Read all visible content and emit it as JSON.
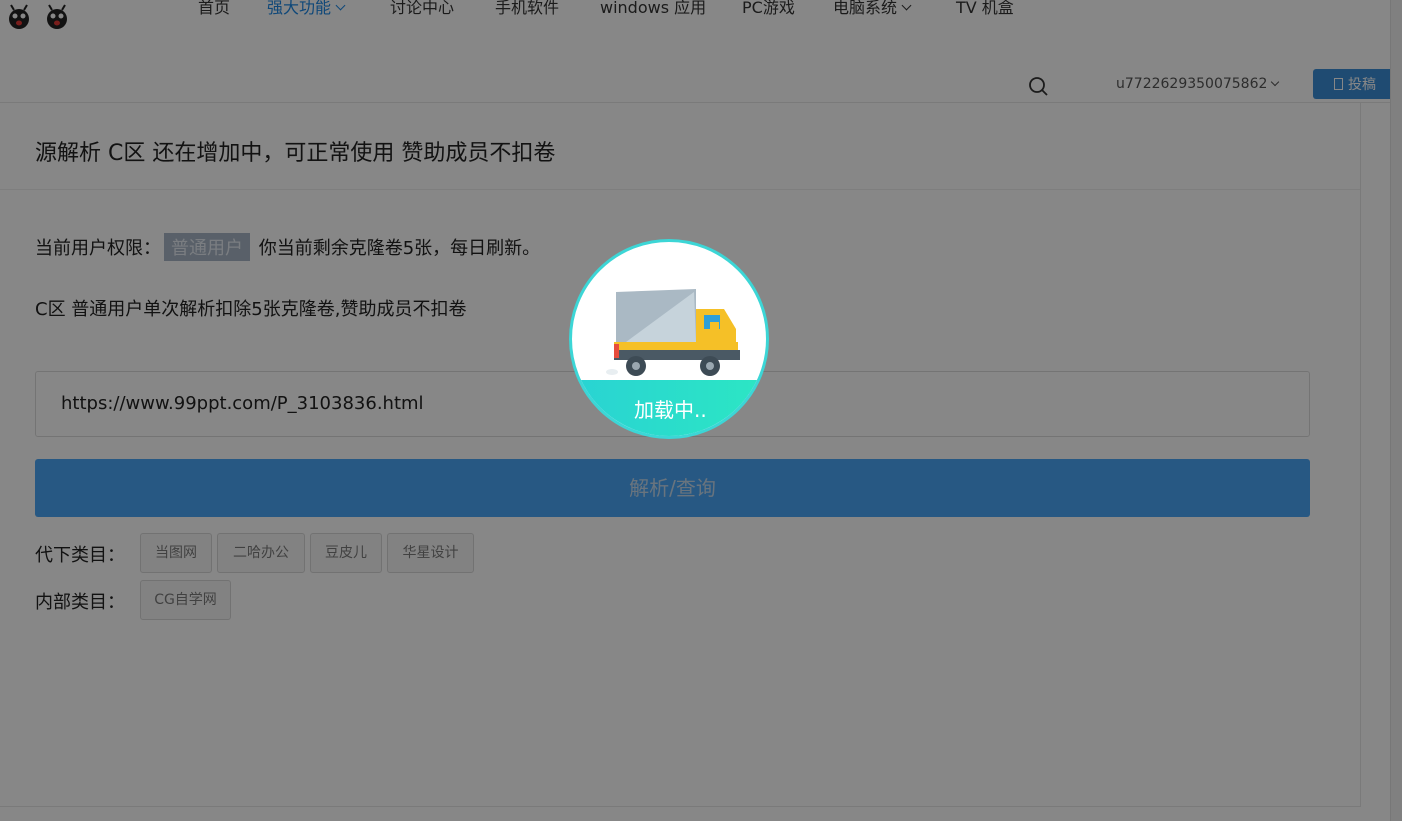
{
  "header": {
    "nav": [
      {
        "label": "首页",
        "dropdown": false,
        "active": false
      },
      {
        "label": "强大功能",
        "dropdown": true,
        "active": true
      },
      {
        "label": "讨论中心",
        "dropdown": false,
        "active": false
      },
      {
        "label": "手机软件",
        "dropdown": false,
        "active": false
      },
      {
        "label": "windows 应用",
        "dropdown": false,
        "active": false
      },
      {
        "label": "PC游戏",
        "dropdown": false,
        "active": false
      },
      {
        "label": "电脑系统",
        "dropdown": true,
        "active": false
      },
      {
        "label": "TV 机盒",
        "dropdown": false,
        "active": false
      }
    ],
    "username": "u7722629350075862",
    "post_label": "投稿"
  },
  "card": {
    "title": "源解析 C区 还在增加中，可正常使用 赞助成员不扣卷",
    "permission_prefix": "当前用户权限：",
    "permission_badge": "普通用户",
    "permission_suffix": "你当前剩余克隆卷5张，每日刷新。",
    "rule_text": "C区 普通用户单次解析扣除5张克隆卷,赞助成员不扣卷",
    "url_value": "https://www.99ppt.com/P_3103836.html",
    "parse_button": "解析/查询",
    "category_rows": [
      {
        "label": "代下类目：",
        "tags": [
          "当图网",
          "二哈办公",
          "豆皮儿",
          "华星设计"
        ]
      },
      {
        "label": "内部类目：",
        "tags": [
          "CG自学网"
        ]
      }
    ]
  },
  "loader": {
    "text": "加载中.."
  },
  "colors": {
    "accent": "#1e88e5",
    "button_blue": "#4aa6f7",
    "loader_ring": "#3cd6d6",
    "overlay": "rgba(0,0,0,0.47)"
  },
  "icons": [
    "bug-icon",
    "search-icon",
    "chevron-down-icon",
    "edit-icon",
    "truck-icon"
  ]
}
